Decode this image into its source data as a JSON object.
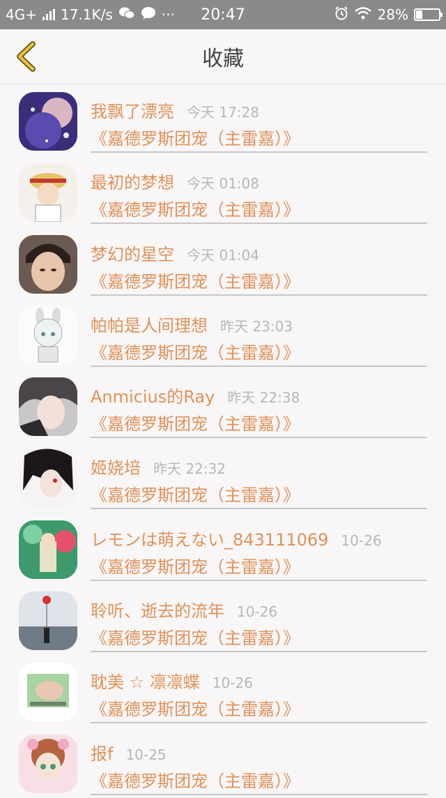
{
  "status_bar": {
    "network": "4G+",
    "speed": "17.1K/s",
    "dots": "···",
    "time": "20:47",
    "battery": "28%",
    "battery_level": 0.28
  },
  "header": {
    "title": "收藏"
  },
  "favorites": [
    {
      "name": "我飘了漂亮",
      "time": "今天 17:28",
      "group": "《嘉德罗斯团宠（主雷嘉）》"
    },
    {
      "name": "最初的梦想",
      "time": "今天 01:08",
      "group": "《嘉德罗斯团宠（主雷嘉）》"
    },
    {
      "name": "梦幻的星空",
      "time": "今天 01:04",
      "group": "《嘉德罗斯团宠（主雷嘉）》"
    },
    {
      "name": "帕帕是人间理想",
      "time": "昨天 23:03",
      "group": "《嘉德罗斯团宠（主雷嘉）》"
    },
    {
      "name": "Anmicius的Ray",
      "time": "昨天 22:38",
      "group": "《嘉德罗斯团宠（主雷嘉）》"
    },
    {
      "name": "姬娆培",
      "time": "昨天 22:32",
      "group": "《嘉德罗斯团宠（主雷嘉）》"
    },
    {
      "name": "レモンは萌えない_843111069",
      "time": "10-26",
      "group": "《嘉德罗斯团宠（主雷嘉）》"
    },
    {
      "name": "聆听、逝去的流年",
      "time": "10-26",
      "group": "《嘉德罗斯团宠（主雷嘉）》"
    },
    {
      "name": "耽美 ☆ 凛凛蝶",
      "time": "10-26",
      "group": "《嘉德罗斯团宠（主雷嘉）》"
    },
    {
      "name": "报f",
      "time": "10-25",
      "group": "《嘉德罗斯团宠（主雷嘉）》"
    }
  ],
  "colors": {
    "accent": "#e0925a",
    "time_gray": "#b8b8b8",
    "back_icon": "#e8c53a"
  }
}
